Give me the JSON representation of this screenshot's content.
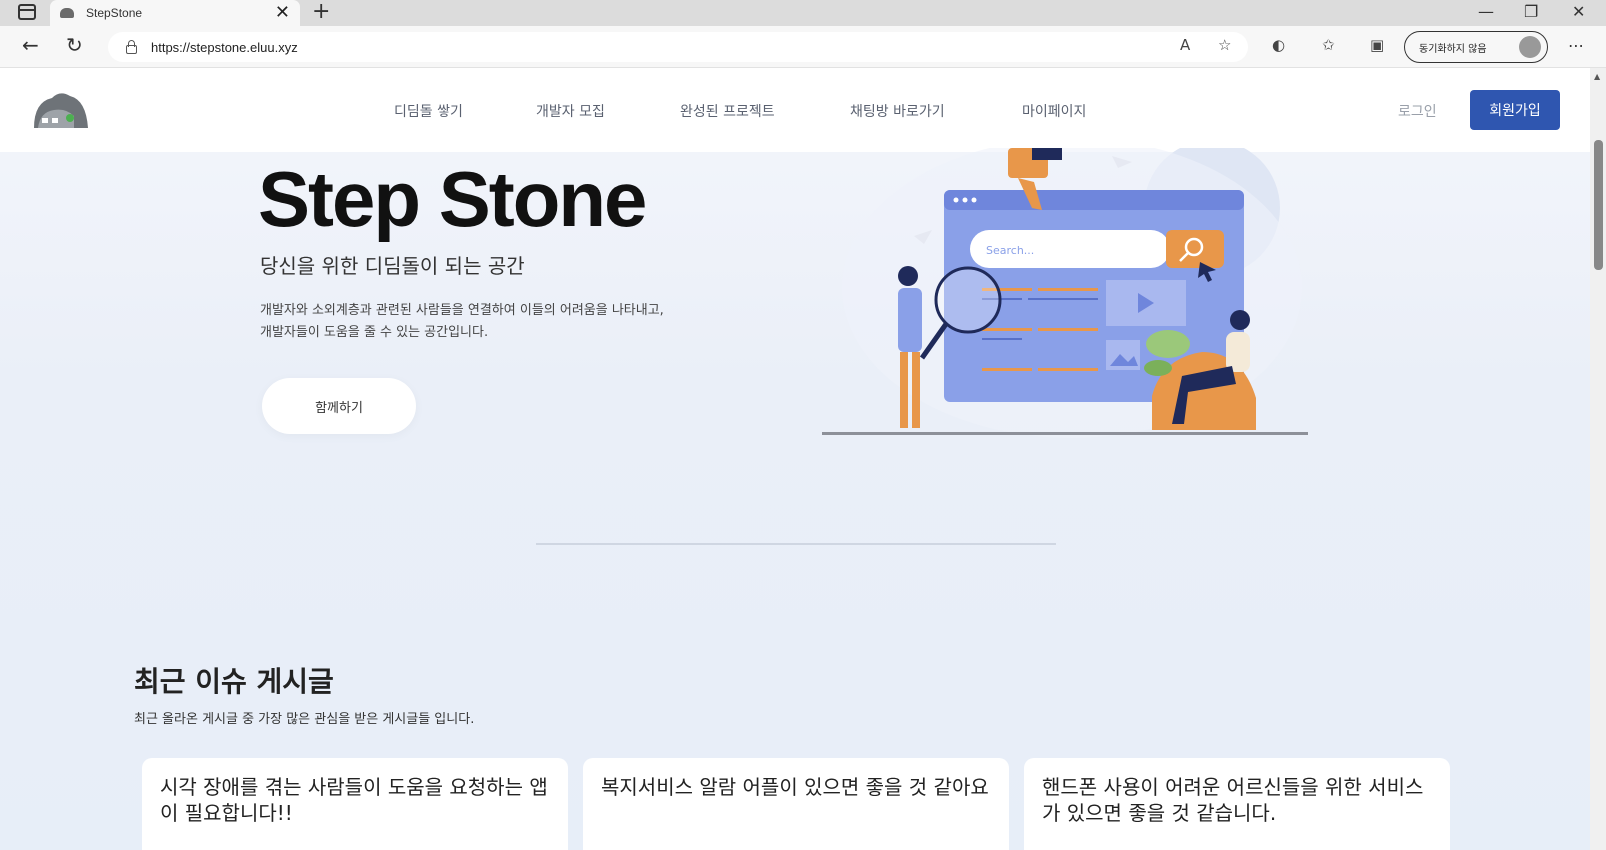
{
  "browser": {
    "tab_title": "StepStone",
    "tab_close": "✕",
    "new_tab": "+",
    "url": "https://stepstone.eluu.xyz",
    "profile_label": "동기화하지 않음",
    "window_minimize": "—",
    "window_restore": "❐",
    "window_close": "✕"
  },
  "header": {
    "nav": [
      "디딤돌 쌓기",
      "개발자 모집",
      "완성된 프로젝트",
      "채팅방 바로가기",
      "마이페이지"
    ],
    "login": "로그인",
    "signup": "회원가입"
  },
  "hero": {
    "title": "Step Stone",
    "subtitle": "당신을 위한 디딤돌이 되는 공간",
    "desc_line1": "개발자와 소외계층과 관련된 사람들을 연결하여 이들의 어려움을 나타내고,",
    "desc_line2": "개발자들이 도움을 줄 수 있는 공간입니다.",
    "cta": "함께하기",
    "search_placeholder": "Search..."
  },
  "issues": {
    "title": "최근 이슈 게시글",
    "desc": "최근 올라온 게시글 중 가장 많은 관심을 받은 게시글들 입니다.",
    "cards": [
      {
        "title": "시각 장애를 겪는 사람들이 도움을 요청하는 앱이 필요합니다!!"
      },
      {
        "title": "복지서비스 알람 어플이 있으면 좋을 것 같아요"
      },
      {
        "title": "핸드폰 사용이 어려운 어르신들을 위한 서비스가 있으면 좋을 것 같습니다."
      }
    ]
  },
  "colors": {
    "primary": "#2f56b0",
    "illustration_blue": "#8aa0e8",
    "illustration_orange": "#e8974a"
  }
}
